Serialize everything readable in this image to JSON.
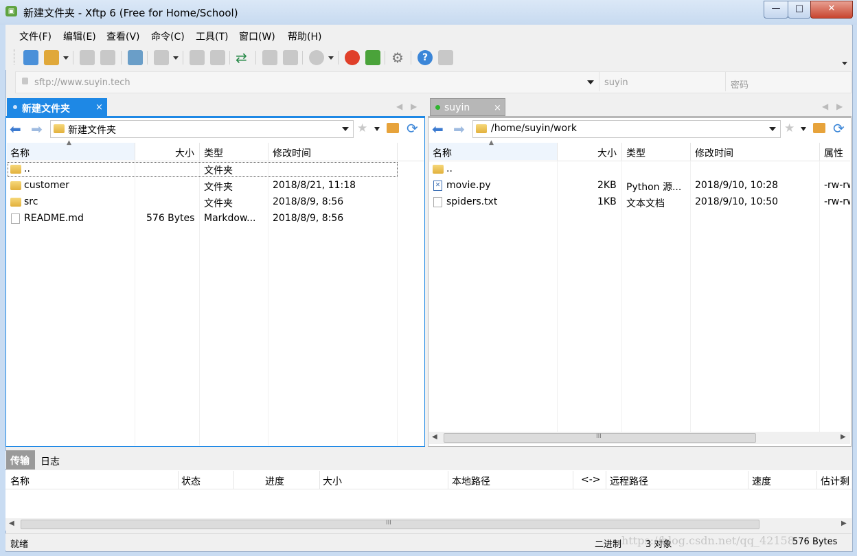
{
  "window": {
    "title": "新建文件夹 - Xftp 6 (Free for Home/School)",
    "app_icon": "xftp-logo-icon",
    "controls": {
      "minimize": "—",
      "maximize": "□",
      "close": "✕"
    }
  },
  "menu": [
    "文件(F)",
    "编辑(E)",
    "查看(V)",
    "命令(C)",
    "工具(T)",
    "窗口(W)",
    "帮助(H)"
  ],
  "address": {
    "url_placeholder": "sftp://www.suyin.tech",
    "user_placeholder": "suyin",
    "password_placeholder": "密码"
  },
  "local": {
    "tab_label": "新建文件夹",
    "tab_close": "×",
    "path": "新建文件夹",
    "columns": [
      "名称",
      "大小",
      "类型",
      "修改时间"
    ],
    "rows": [
      {
        "name": "..",
        "size": "",
        "type": "文件夹",
        "modified": "",
        "icon": "folder-icon"
      },
      {
        "name": "customer",
        "size": "",
        "type": "文件夹",
        "modified": "2018/8/21, 11:18",
        "icon": "folder-icon"
      },
      {
        "name": "src",
        "size": "",
        "type": "文件夹",
        "modified": "2018/8/9, 8:56",
        "icon": "folder-icon"
      },
      {
        "name": "README.md",
        "size": "576 Bytes",
        "type": "Markdow...",
        "modified": "2018/8/9, 8:56",
        "icon": "markdown-file-icon"
      }
    ]
  },
  "remote": {
    "tab_label": "suyin",
    "tab_close": "×",
    "path": "/home/suyin/work",
    "columns": [
      "名称",
      "大小",
      "类型",
      "修改时间",
      "属性"
    ],
    "rows": [
      {
        "name": "..",
        "size": "",
        "type": "",
        "modified": "",
        "attr": "",
        "icon": "folder-icon"
      },
      {
        "name": "movie.py",
        "size": "2KB",
        "type": "Python 源...",
        "modified": "2018/9/10, 10:28",
        "attr": "-rw-rw",
        "icon": "python-file-icon"
      },
      {
        "name": "spiders.txt",
        "size": "1KB",
        "type": "文本文档",
        "modified": "2018/9/10, 10:50",
        "attr": "-rw-rw",
        "icon": "text-file-icon"
      }
    ]
  },
  "bottom": {
    "tabs": [
      "传输",
      "日志"
    ],
    "columns": [
      "名称",
      "状态",
      "进度",
      "大小",
      "本地路径",
      "<->",
      "远程路径",
      "速度",
      "估计剩"
    ]
  },
  "status": {
    "left": "就绪",
    "mode": "二进制",
    "objects": "3 对象",
    "size": "576 Bytes",
    "watermark": "https://blog.csdn.net/qq_42158"
  },
  "scroll_grip": "III",
  "colors": {
    "accent": "#1e88e5",
    "title_bg": "#c7daf0",
    "remote_tab": "#b7b7b7"
  }
}
